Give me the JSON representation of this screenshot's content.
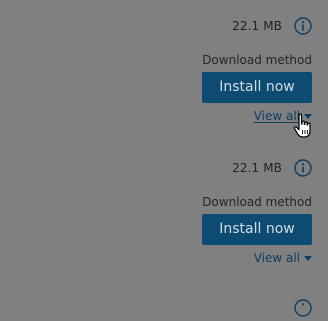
{
  "items": [
    {
      "size": "22.1 MB",
      "download_method_label": "Download method",
      "install_label": "Install now",
      "view_all_label": "View all"
    },
    {
      "size": "22.1 MB",
      "download_method_label": "Download method",
      "install_label": "Install now",
      "view_all_label": "View all"
    }
  ],
  "colors": {
    "background": "#808080",
    "button": "#0e4b73",
    "button_text": "#d2dbe2",
    "link": "#0e3d60",
    "text": "#222222"
  },
  "icons": {
    "info": "info-icon",
    "caret": "caret-down-icon",
    "cursor": "hand-pointer-icon"
  }
}
